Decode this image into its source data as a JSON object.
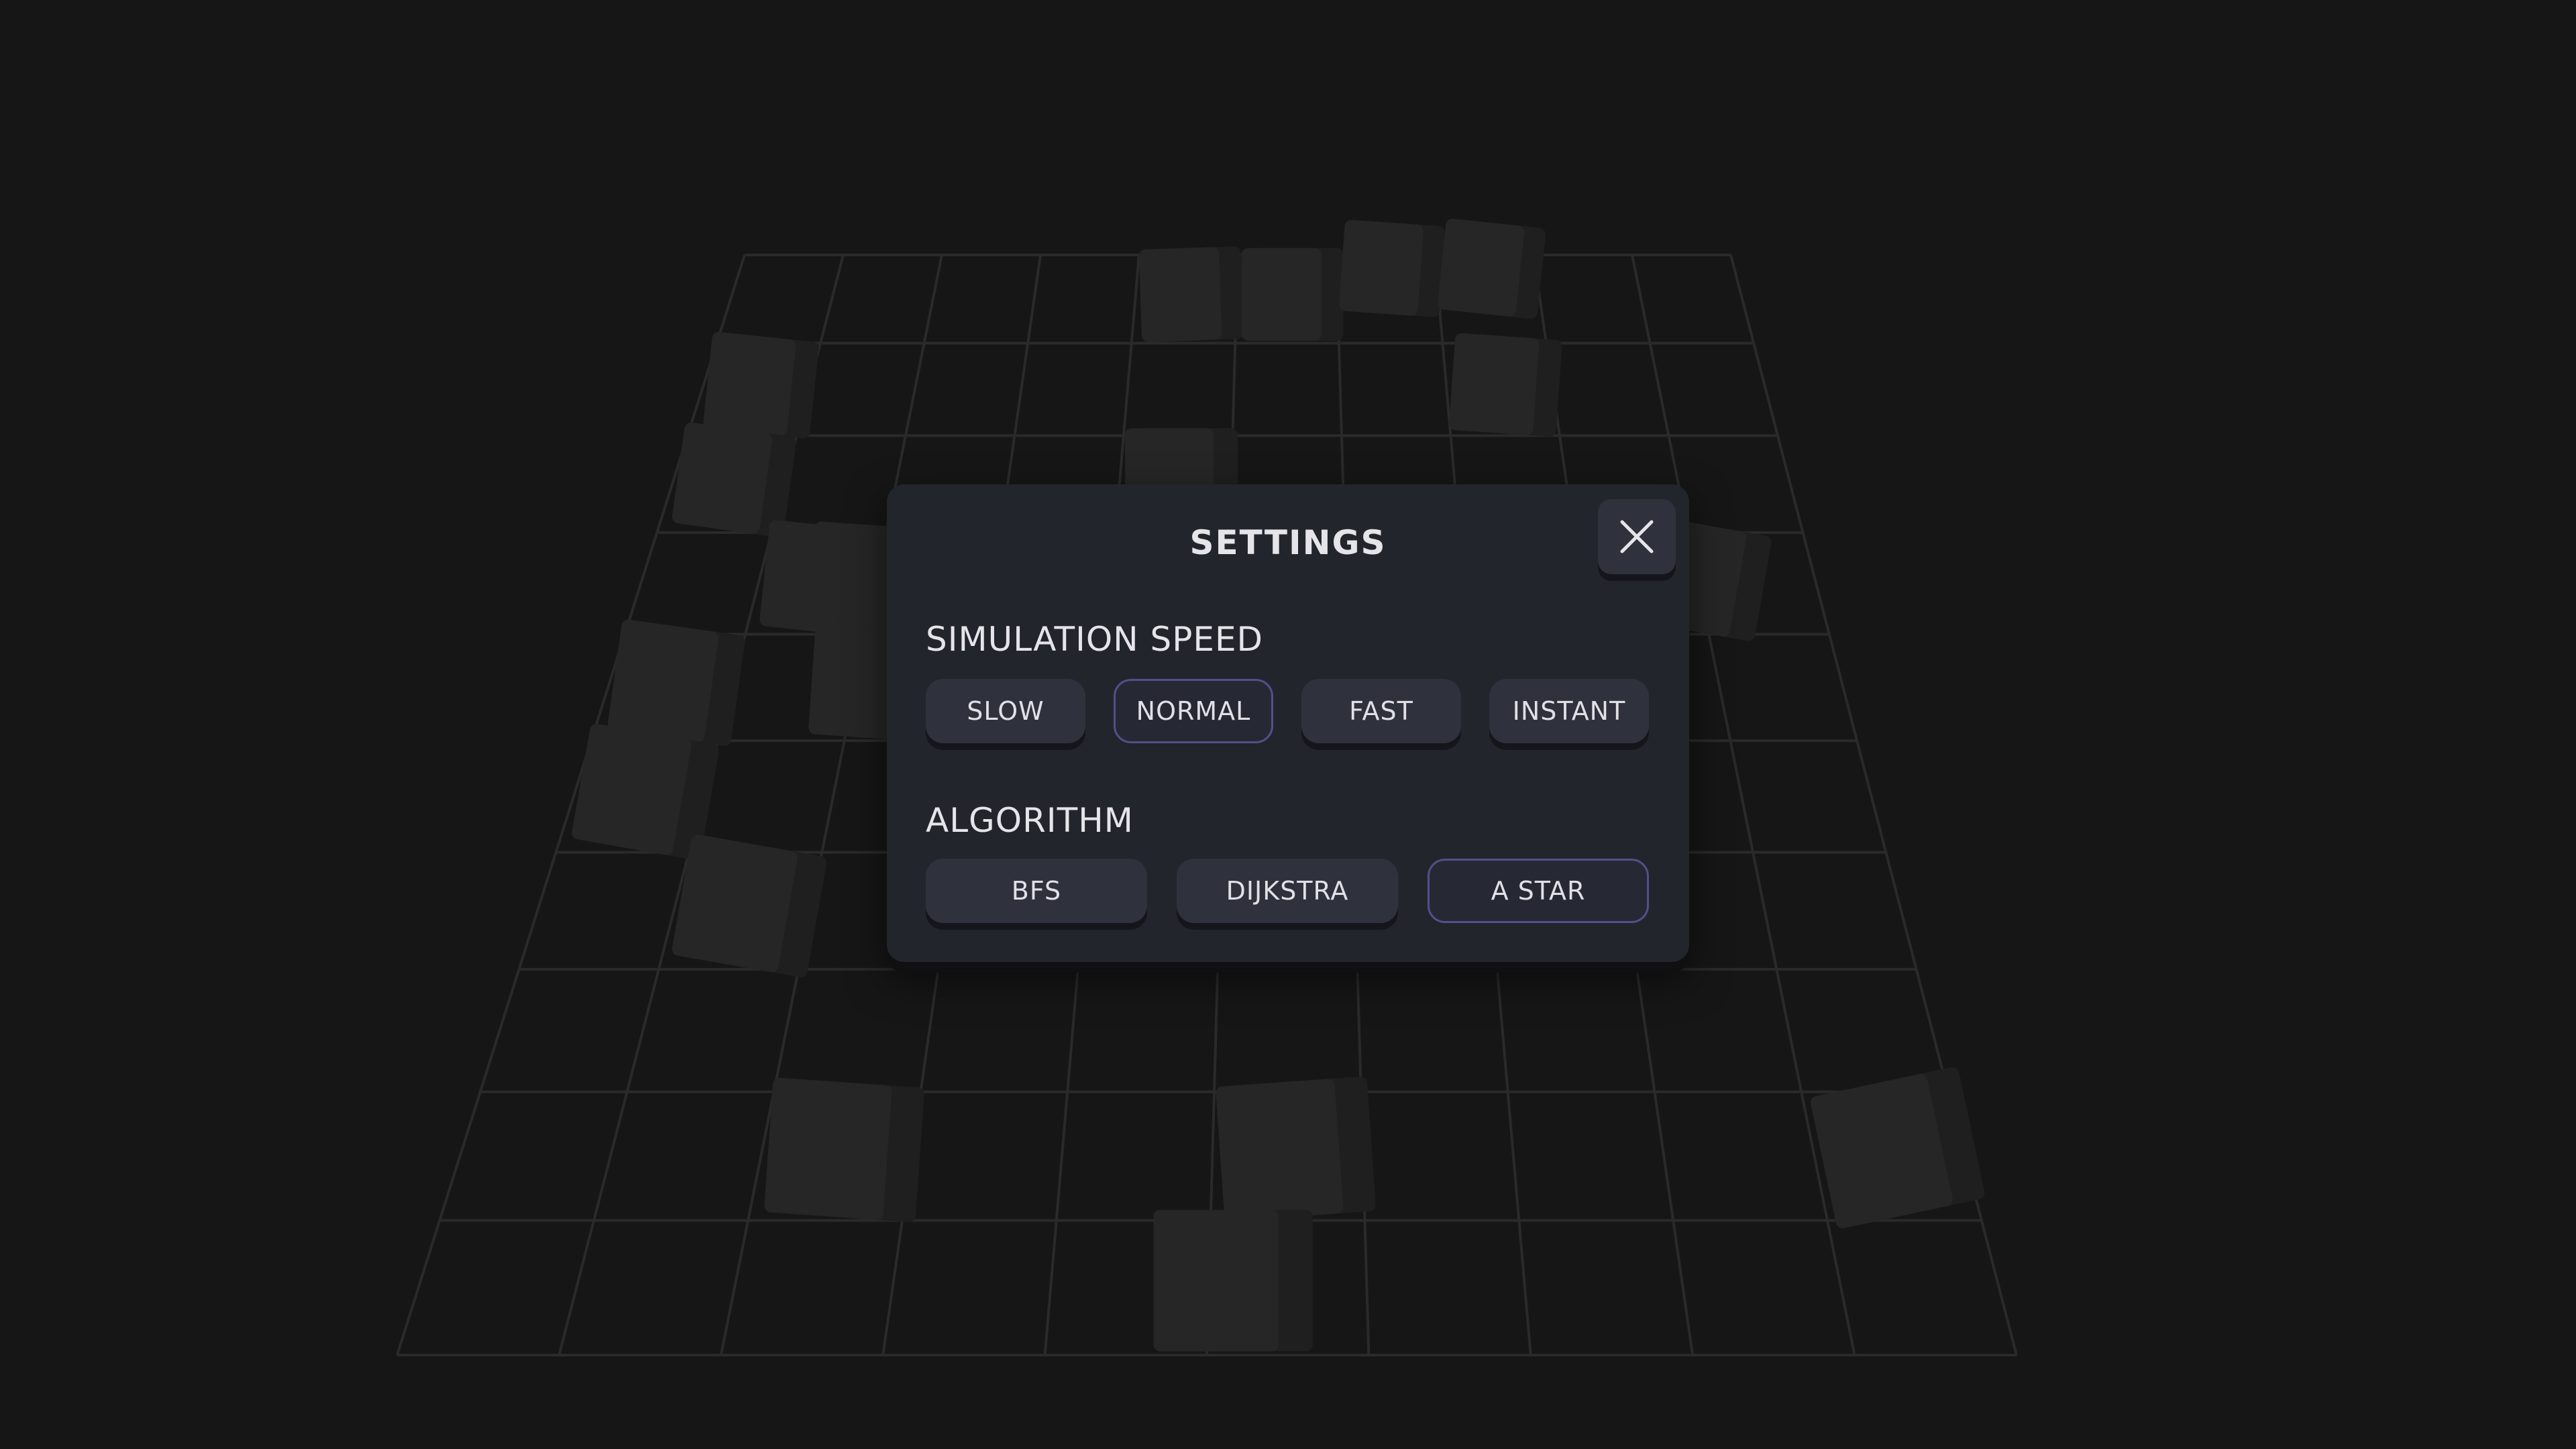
{
  "settings": {
    "title": "SETTINGS",
    "close_icon": "close-icon",
    "speed": {
      "label": "SIMULATION SPEED",
      "options": [
        "SLOW",
        "NORMAL",
        "FAST",
        "INSTANT"
      ],
      "selected": "NORMAL"
    },
    "algorithm": {
      "label": "ALGORITHM",
      "options": [
        "BFS",
        "DIJKSTRA",
        "A STAR"
      ],
      "selected": "A STAR"
    }
  },
  "colors": {
    "background": "#161616",
    "grid_line": "#2a2a2a",
    "block": "#262626",
    "panel": "#23252d",
    "button": "#2f313c",
    "selected_border": "#52508a",
    "text": "#e5e5e9"
  }
}
